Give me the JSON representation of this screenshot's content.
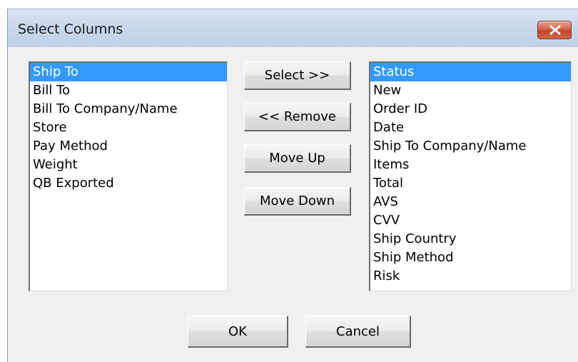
{
  "dialog": {
    "title": "Select Columns",
    "close_icon": "close-icon"
  },
  "available_columns": {
    "items": [
      {
        "label": "Ship To",
        "selected": true
      },
      {
        "label": "Bill To",
        "selected": false
      },
      {
        "label": "Bill To Company/Name",
        "selected": false
      },
      {
        "label": "Store",
        "selected": false
      },
      {
        "label": "Pay Method",
        "selected": false
      },
      {
        "label": "Weight",
        "selected": false
      },
      {
        "label": "QB Exported",
        "selected": false
      }
    ]
  },
  "selected_columns": {
    "items": [
      {
        "label": "Status",
        "selected": true
      },
      {
        "label": "New",
        "selected": false
      },
      {
        "label": "Order ID",
        "selected": false
      },
      {
        "label": "Date",
        "selected": false
      },
      {
        "label": "Ship To Company/Name",
        "selected": false
      },
      {
        "label": "Items",
        "selected": false
      },
      {
        "label": "Total",
        "selected": false
      },
      {
        "label": "AVS",
        "selected": false
      },
      {
        "label": "CVV",
        "selected": false
      },
      {
        "label": "Ship Country",
        "selected": false
      },
      {
        "label": "Ship Method",
        "selected": false
      },
      {
        "label": "Risk",
        "selected": false
      }
    ]
  },
  "actions": {
    "select_label": "Select >>",
    "remove_label": "<< Remove",
    "move_up_label": "Move Up",
    "move_down_label": "Move Down"
  },
  "footer": {
    "ok_label": "OK",
    "cancel_label": "Cancel"
  },
  "colors": {
    "selection": "#3399ff",
    "close_button": "#c2432b",
    "dialog_background": "#f0f0f0"
  }
}
